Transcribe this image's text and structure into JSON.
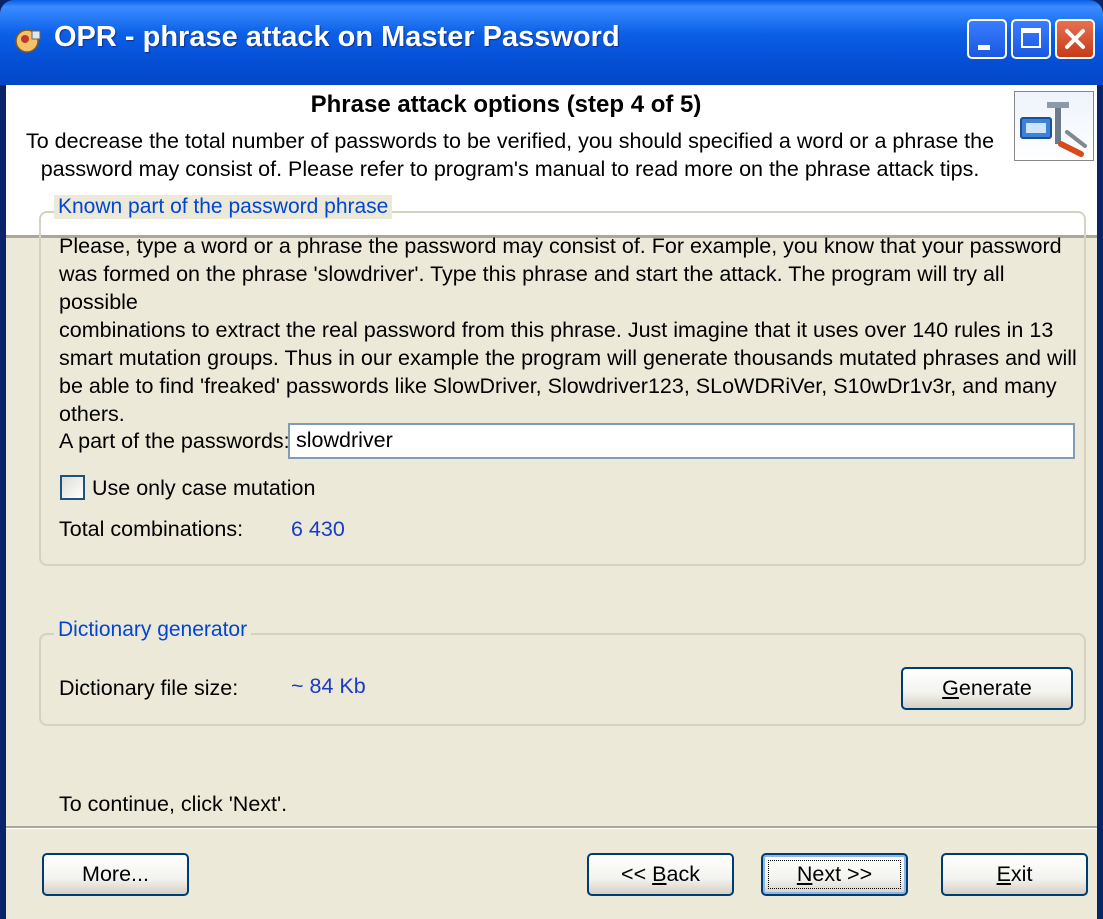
{
  "window": {
    "title": "OPR - phrase attack on Master Password"
  },
  "header": {
    "title": "Phrase attack options (step 4 of 5)",
    "line1": "To decrease the total number of passwords to be verified, you should specified a word or a phrase the",
    "line2": "password may consist of. Please refer to program's manual to read more on the phrase attack tips."
  },
  "known_part": {
    "legend": "Known part of the password phrase",
    "lines": [
      "Please, type a word or a phrase the password may consist of. For example, you know that your password",
      "was formed on the phrase 'slowdriver'. Type this phrase and start the attack. The program will try all possible",
      "combinations to extract the real password from this phrase. Just imagine that it uses over 140 rules in 13",
      "smart mutation groups. Thus in our example the program will generate thousands mutated phrases and will",
      "be able to find 'freaked' passwords like SlowDriver, Slowdriver123, SLoWDRiVer, S10wDr1v3r, and many",
      "others."
    ],
    "field_label": "A part of the passwords:",
    "field_value": "slowdriver",
    "checkbox_label": "Use only case mutation",
    "checkbox_checked": false,
    "total_label": "Total combinations:",
    "total_value": "6 430"
  },
  "dictionary": {
    "legend": "Dictionary generator",
    "size_label": "Dictionary file size:",
    "size_value": "~ 84  Kb",
    "generate_label": "Generate"
  },
  "continue_text": "To continue, click 'Next'.",
  "buttons": {
    "more": "More...",
    "back": "<< Back",
    "next": "Next >>",
    "exit": "Exit"
  },
  "icons": {
    "title": "key-lock-icon",
    "header": "plug-tools-icon"
  }
}
